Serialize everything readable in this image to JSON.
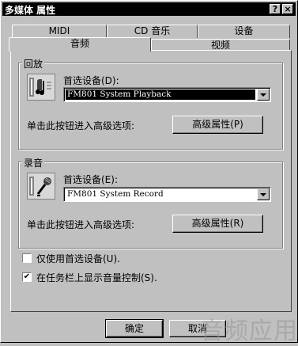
{
  "window": {
    "title": "多媒体 属性",
    "help_button": "?",
    "close_button": "×"
  },
  "tabs": {
    "back_row": [
      "MIDI",
      "CD 音乐",
      "设备"
    ],
    "front_row": [
      "音频",
      "视频"
    ],
    "selected": "音频"
  },
  "playback": {
    "group_title": "回放",
    "device_label": "首选设备(D):",
    "device_value": "FM801 System Playback",
    "advanced_hint": "单击此按钮进入高级选项:",
    "advanced_button": "高级属性(P)"
  },
  "record": {
    "group_title": "录音",
    "device_label": "首选设备(E):",
    "device_value": "FM801 System Record",
    "advanced_hint": "单击此按钮进入高级选项:",
    "advanced_button": "高级属性(R)"
  },
  "options": {
    "use_preferred_only": {
      "label": "仅使用首选设备(U).",
      "checked": false
    },
    "show_volume_taskbar": {
      "label": "在任务栏上显示音量控制(S).",
      "checked": true
    }
  },
  "footer": {
    "ok_button": "确定",
    "cancel_button": "取消"
  },
  "watermark": "音频应用"
}
